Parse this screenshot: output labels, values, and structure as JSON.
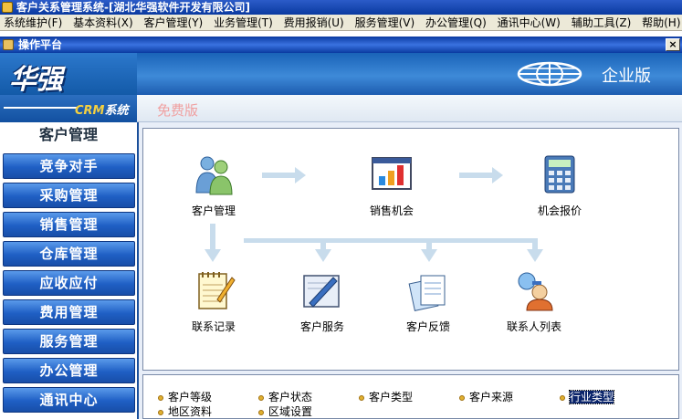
{
  "window": {
    "title": "客户关系管理系统-[湖北华强软件开发有限公司]"
  },
  "menu": {
    "items": [
      {
        "label": "系统维护(F)"
      },
      {
        "label": "基本资料(X)"
      },
      {
        "label": "客户管理(Y)"
      },
      {
        "label": "业务管理(T)"
      },
      {
        "label": "费用报销(U)"
      },
      {
        "label": "服务管理(V)"
      },
      {
        "label": "办公管理(Q)"
      },
      {
        "label": "通讯中心(W)"
      },
      {
        "label": "辅助工具(Z)"
      },
      {
        "label": "帮助(H)"
      }
    ]
  },
  "child_window": {
    "title": "操作平台",
    "close_label": "×"
  },
  "banner": {
    "logo": "华强",
    "crm_label_prefix": "CRM",
    "crm_label_suffix": "系统",
    "edition": "企业版",
    "free_label": "免费版"
  },
  "sidebar": {
    "header": "客户管理",
    "items": [
      {
        "label": "竞争对手"
      },
      {
        "label": "采购管理"
      },
      {
        "label": "销售管理"
      },
      {
        "label": "仓库管理"
      },
      {
        "label": "应收应付"
      },
      {
        "label": "费用管理"
      },
      {
        "label": "服务管理"
      },
      {
        "label": "办公管理"
      },
      {
        "label": "通讯中心"
      }
    ]
  },
  "flow": {
    "nodes": [
      {
        "label": "客户管理",
        "icon": "people-icon"
      },
      {
        "label": "销售机会",
        "icon": "bar-chart-icon"
      },
      {
        "label": "机会报价",
        "icon": "calculator-icon"
      },
      {
        "label": "联系记录",
        "icon": "notepad-icon"
      },
      {
        "label": "客户服务",
        "icon": "pen-board-icon"
      },
      {
        "label": "客户反馈",
        "icon": "documents-icon"
      },
      {
        "label": "联系人列表",
        "icon": "contacts-icon"
      }
    ]
  },
  "quick_links": {
    "items": [
      {
        "label": "客户等级"
      },
      {
        "label": "客户状态"
      },
      {
        "label": "客户类型"
      },
      {
        "label": "客户来源"
      },
      {
        "label": "行业类型"
      },
      {
        "label": "地区资料"
      },
      {
        "label": "区域设置"
      }
    ]
  },
  "colors": {
    "sidebar_button": "#1f5fc4",
    "banner": "#1a63b8",
    "selection": "#0a246a"
  }
}
